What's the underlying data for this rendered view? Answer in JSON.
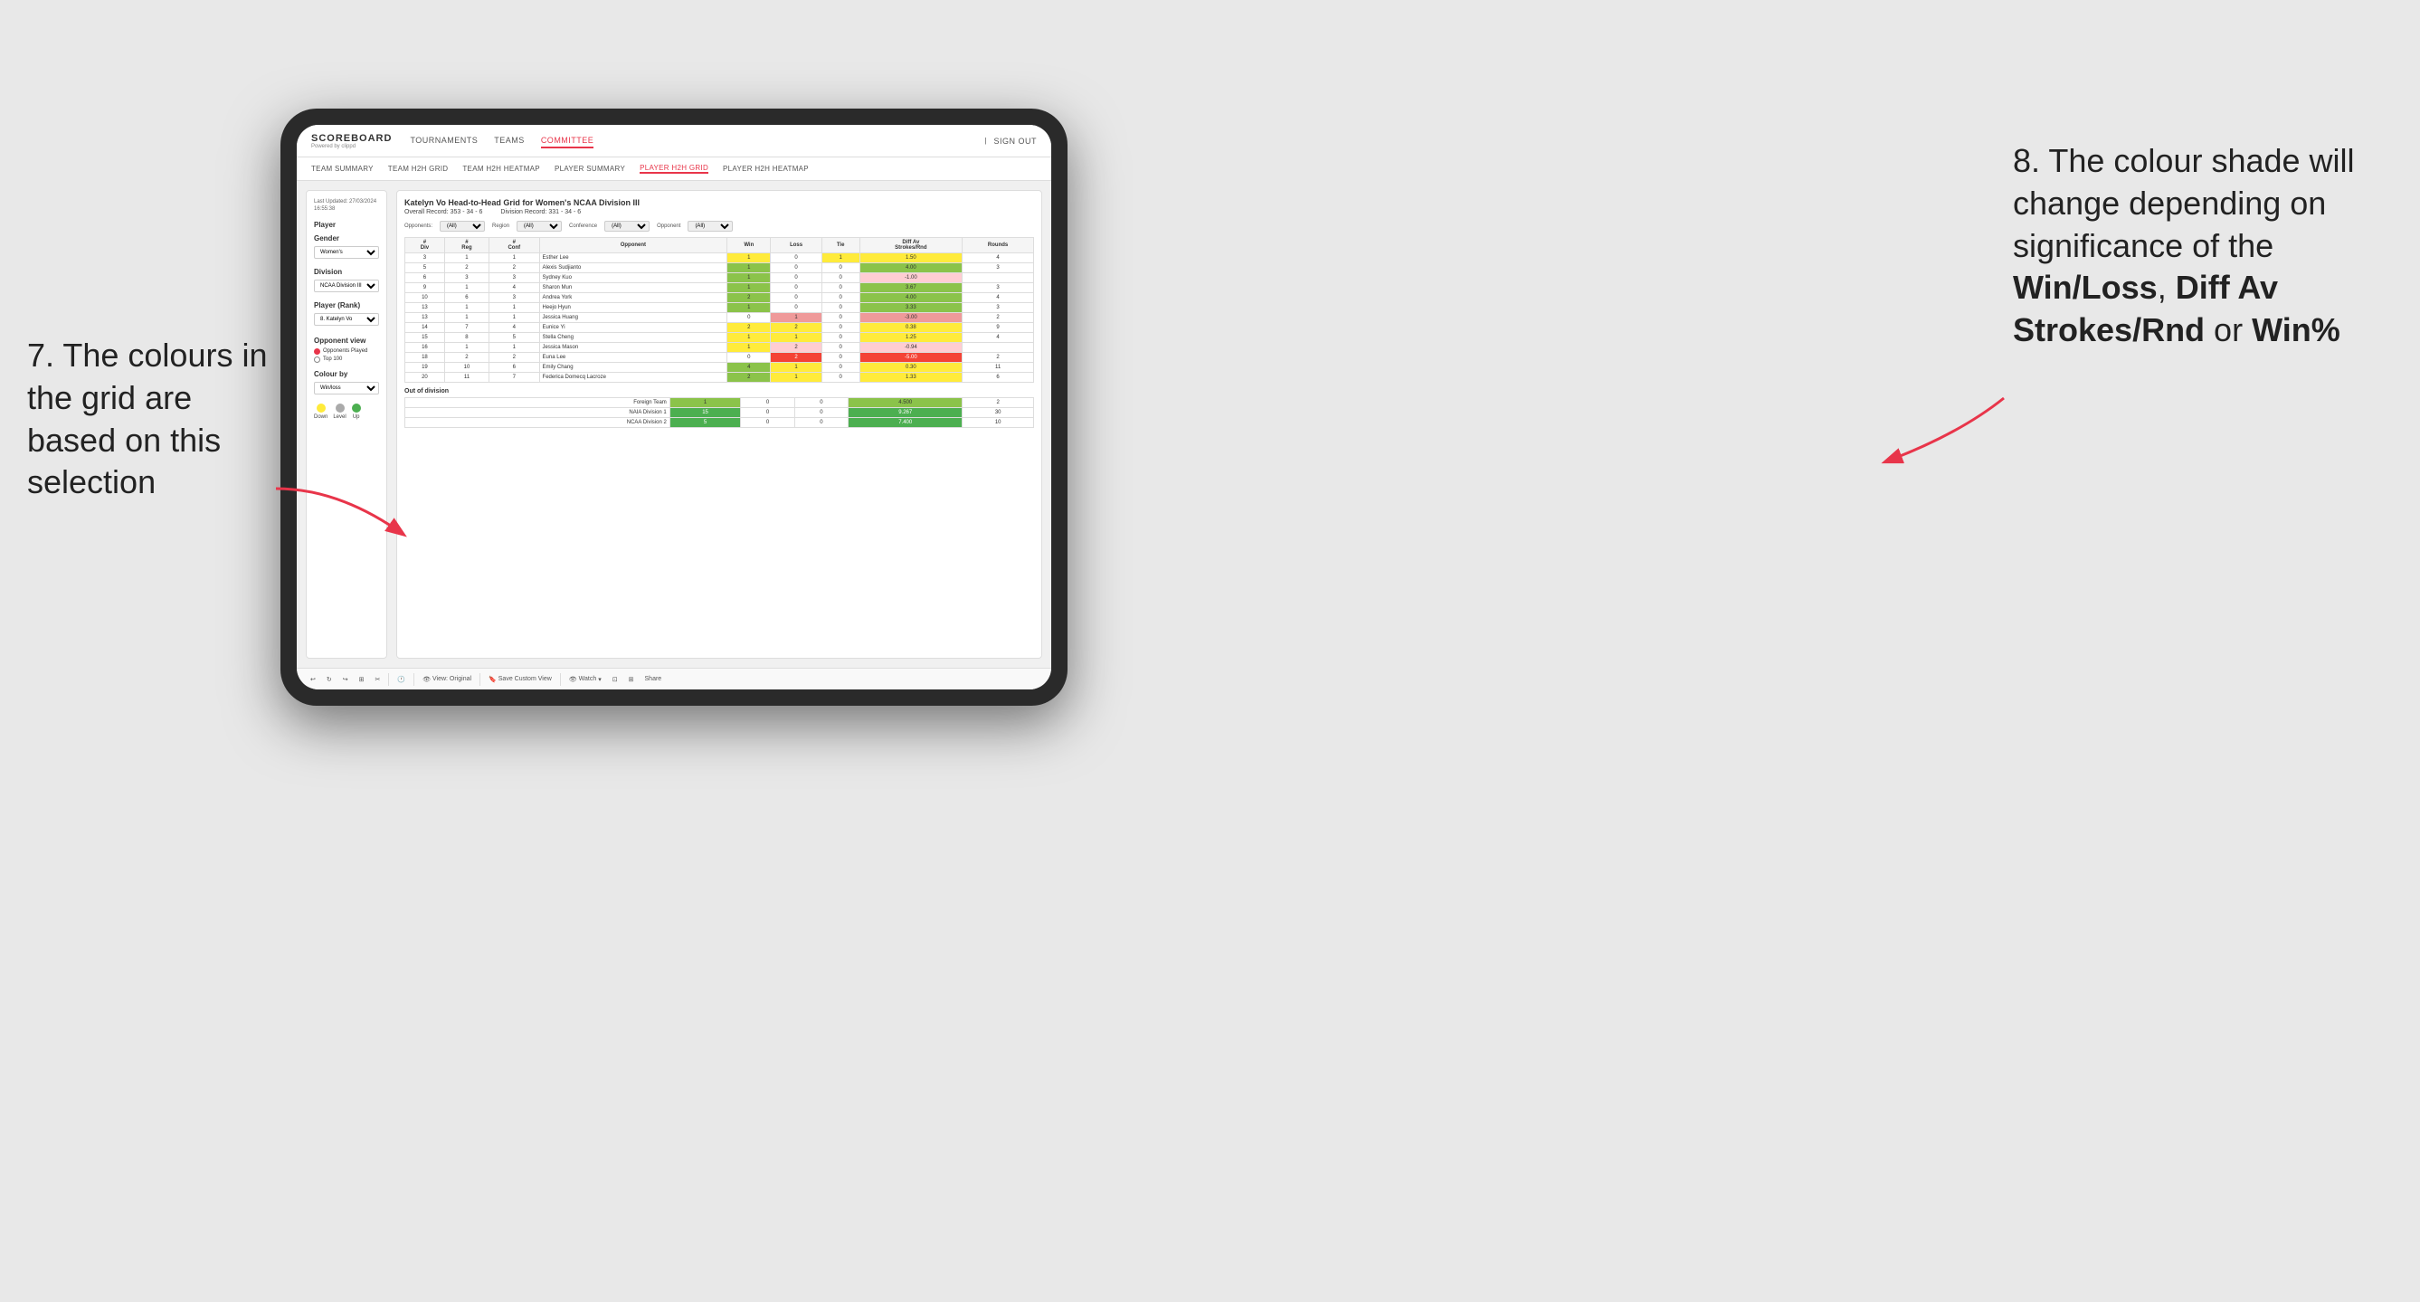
{
  "annotations": {
    "left_title": "7. The colours in the grid are based on this selection",
    "right_title": "8. The colour shade will change depending on significance of the ",
    "right_bold1": "Win/Loss",
    "right_sep1": ", ",
    "right_bold2": "Diff Av Strokes/Rnd",
    "right_sep2": " or ",
    "right_bold3": "Win%"
  },
  "header": {
    "logo": "SCOREBOARD",
    "logo_sub": "Powered by clippd",
    "nav": [
      "TOURNAMENTS",
      "TEAMS",
      "COMMITTEE"
    ],
    "active_nav": "COMMITTEE",
    "sign_out": "Sign out"
  },
  "sub_nav": {
    "tabs": [
      "TEAM SUMMARY",
      "TEAM H2H GRID",
      "TEAM H2H HEATMAP",
      "PLAYER SUMMARY",
      "PLAYER H2H GRID",
      "PLAYER H2H HEATMAP"
    ],
    "active": "PLAYER H2H GRID"
  },
  "left_panel": {
    "last_updated_label": "Last Updated: 27/03/2024",
    "last_updated_time": "16:55:38",
    "player_label": "Player",
    "gender_label": "Gender",
    "gender_value": "Women's",
    "division_label": "Division",
    "division_value": "NCAA Division III",
    "player_rank_label": "Player (Rank)",
    "player_rank_value": "8. Katelyn Vo",
    "opponent_view_label": "Opponent view",
    "opponents_played": "Opponents Played",
    "top_100": "Top 100",
    "colour_by_label": "Colour by",
    "colour_by_value": "Win/loss",
    "legend_down": "Down",
    "legend_level": "Level",
    "legend_up": "Up"
  },
  "grid": {
    "title": "Katelyn Vo Head-to-Head Grid for Women's NCAA Division III",
    "overall_record_label": "Overall Record:",
    "overall_record": "353 - 34 - 6",
    "division_record_label": "Division Record:",
    "division_record": "331 - 34 - 6",
    "filter_opponents_label": "Opponents:",
    "filter_region_label": "Region",
    "filter_conference_label": "Conference",
    "filter_opponent_label": "Opponent",
    "filter_all": "(All)",
    "columns": [
      "#\nDiv",
      "#\nReg",
      "#\nConf",
      "Opponent",
      "Win",
      "Loss",
      "Tie",
      "Diff Av\nStrokes/Rnd",
      "Rounds"
    ],
    "rows": [
      {
        "div": "3",
        "reg": "1",
        "conf": "1",
        "opponent": "Esther Lee",
        "win": "1",
        "loss": "0",
        "tie": "1",
        "diff": "1.50",
        "rounds": "4",
        "win_color": "yellow",
        "loss_color": "white",
        "tie_color": "yellow",
        "diff_color": "yellow"
      },
      {
        "div": "5",
        "reg": "2",
        "conf": "2",
        "opponent": "Alexis Sudjianto",
        "win": "1",
        "loss": "0",
        "tie": "0",
        "diff": "4.00",
        "rounds": "3",
        "win_color": "green-mid",
        "loss_color": "white",
        "tie_color": "white",
        "diff_color": "green-mid"
      },
      {
        "div": "6",
        "reg": "3",
        "conf": "3",
        "opponent": "Sydney Kuo",
        "win": "1",
        "loss": "0",
        "tie": "0",
        "diff": "-1.00",
        "rounds": "",
        "win_color": "green-mid",
        "loss_color": "white",
        "tie_color": "white",
        "diff_color": "red-light"
      },
      {
        "div": "9",
        "reg": "1",
        "conf": "4",
        "opponent": "Sharon Mun",
        "win": "1",
        "loss": "0",
        "tie": "0",
        "diff": "3.67",
        "rounds": "3",
        "win_color": "green-mid",
        "loss_color": "white",
        "tie_color": "white",
        "diff_color": "green-mid"
      },
      {
        "div": "10",
        "reg": "6",
        "conf": "3",
        "opponent": "Andrea York",
        "win": "2",
        "loss": "0",
        "tie": "0",
        "diff": "4.00",
        "rounds": "4",
        "win_color": "green-mid",
        "loss_color": "white",
        "tie_color": "white",
        "diff_color": "green-mid"
      },
      {
        "div": "13",
        "reg": "1",
        "conf": "1",
        "opponent": "Heejo Hyun",
        "win": "1",
        "loss": "0",
        "tie": "0",
        "diff": "3.33",
        "rounds": "3",
        "win_color": "green-mid",
        "loss_color": "white",
        "tie_color": "white",
        "diff_color": "green-mid"
      },
      {
        "div": "13",
        "reg": "1",
        "conf": "1",
        "opponent": "Jessica Huang",
        "win": "0",
        "loss": "1",
        "tie": "0",
        "diff": "-3.00",
        "rounds": "2",
        "win_color": "white",
        "loss_color": "red-mid",
        "tie_color": "white",
        "diff_color": "red-mid"
      },
      {
        "div": "14",
        "reg": "7",
        "conf": "4",
        "opponent": "Eunice Yi",
        "win": "2",
        "loss": "2",
        "tie": "0",
        "diff": "0.38",
        "rounds": "9",
        "win_color": "yellow",
        "loss_color": "yellow",
        "tie_color": "white",
        "diff_color": "yellow"
      },
      {
        "div": "15",
        "reg": "8",
        "conf": "5",
        "opponent": "Stella Cheng",
        "win": "1",
        "loss": "1",
        "tie": "0",
        "diff": "1.25",
        "rounds": "4",
        "win_color": "yellow",
        "loss_color": "yellow",
        "tie_color": "white",
        "diff_color": "yellow"
      },
      {
        "div": "16",
        "reg": "1",
        "conf": "1",
        "opponent": "Jessica Mason",
        "win": "1",
        "loss": "2",
        "tie": "0",
        "diff": "-0.94",
        "rounds": "",
        "win_color": "yellow",
        "loss_color": "red-light",
        "tie_color": "white",
        "diff_color": "red-light"
      },
      {
        "div": "18",
        "reg": "2",
        "conf": "2",
        "opponent": "Euna Lee",
        "win": "0",
        "loss": "2",
        "tie": "0",
        "diff": "-5.00",
        "rounds": "2",
        "win_color": "white",
        "loss_color": "red-dark",
        "tie_color": "white",
        "diff_color": "red-dark"
      },
      {
        "div": "19",
        "reg": "10",
        "conf": "6",
        "opponent": "Emily Chang",
        "win": "4",
        "loss": "1",
        "tie": "0",
        "diff": "0.30",
        "rounds": "11",
        "win_color": "green-mid",
        "loss_color": "yellow",
        "tie_color": "white",
        "diff_color": "yellow"
      },
      {
        "div": "20",
        "reg": "11",
        "conf": "7",
        "opponent": "Federica Domecq Lacroze",
        "win": "2",
        "loss": "1",
        "tie": "0",
        "diff": "1.33",
        "rounds": "6",
        "win_color": "green-mid",
        "loss_color": "yellow",
        "tie_color": "white",
        "diff_color": "yellow"
      }
    ],
    "out_of_division_label": "Out of division",
    "out_rows": [
      {
        "opponent": "Foreign Team",
        "win": "1",
        "loss": "0",
        "tie": "0",
        "diff": "4.500",
        "rounds": "2",
        "win_color": "green-mid"
      },
      {
        "opponent": "NAIA Division 1",
        "win": "15",
        "loss": "0",
        "tie": "0",
        "diff": "9.267",
        "rounds": "30",
        "win_color": "green-dark"
      },
      {
        "opponent": "NCAA Division 2",
        "win": "5",
        "loss": "0",
        "tie": "0",
        "diff": "7.400",
        "rounds": "10",
        "win_color": "green-dark"
      }
    ]
  },
  "toolbar": {
    "view_original": "View: Original",
    "save_custom": "Save Custom View",
    "watch": "Watch",
    "share": "Share"
  }
}
